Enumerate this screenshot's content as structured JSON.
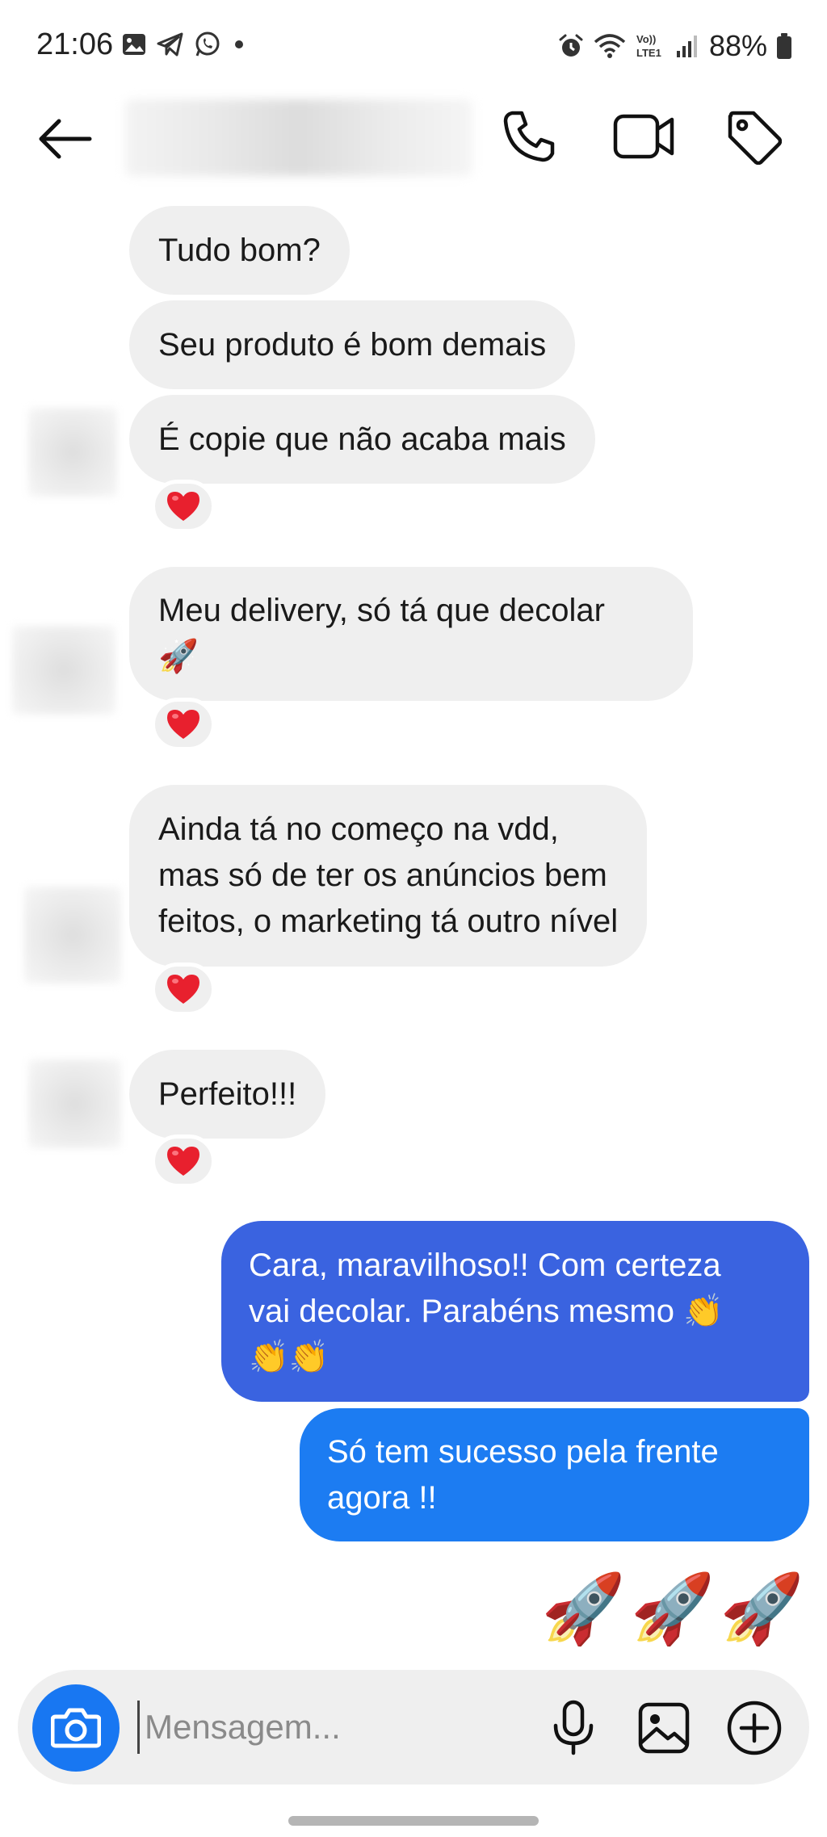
{
  "status_bar": {
    "time": "21:06",
    "battery": "88%",
    "network_label": "LTE1"
  },
  "header": {
    "back_icon": "arrow-left-icon",
    "call_icon": "phone-icon",
    "video_icon": "video-camera-icon",
    "label_icon": "tag-icon"
  },
  "messages": {
    "m1": "Tudo bom?",
    "m2": "Seu produto é bom demais",
    "m3": "É copie que não acaba mais",
    "m3_reaction": "❤️",
    "m4_line1": "Meu delivery, só tá que decolar",
    "m4_line2": "🚀",
    "m4_reaction": "❤️",
    "m5_line1": "Ainda tá no começo na vdd,",
    "m5_line2": "mas só de ter os anúncios bem",
    "m5_line3": "feitos, o marketing tá outro nível",
    "m5_reaction": "❤️",
    "m6": "Perfeito!!!",
    "m6_reaction": "❤️",
    "m7_line1": "Cara, maravilhoso!! Com certeza",
    "m7_line2": "vai decolar. Parabéns mesmo 👏",
    "m7_line3": "👏👏",
    "m8_line1": "Só tem sucesso pela frente",
    "m8_line2": "agora !!",
    "m9": "🚀🚀🚀"
  },
  "composer": {
    "placeholder": "Mensagem...",
    "camera_icon": "camera-icon",
    "mic_icon": "microphone-icon",
    "gallery_icon": "image-icon",
    "plus_icon": "plus-circle-icon"
  },
  "colors": {
    "incoming_bubble": "#efefef",
    "outgoing_top": "#3a63e0",
    "outgoing_bottom": "#1c7cf2",
    "camera_button": "#1877f2",
    "heart": "#e8202e"
  }
}
